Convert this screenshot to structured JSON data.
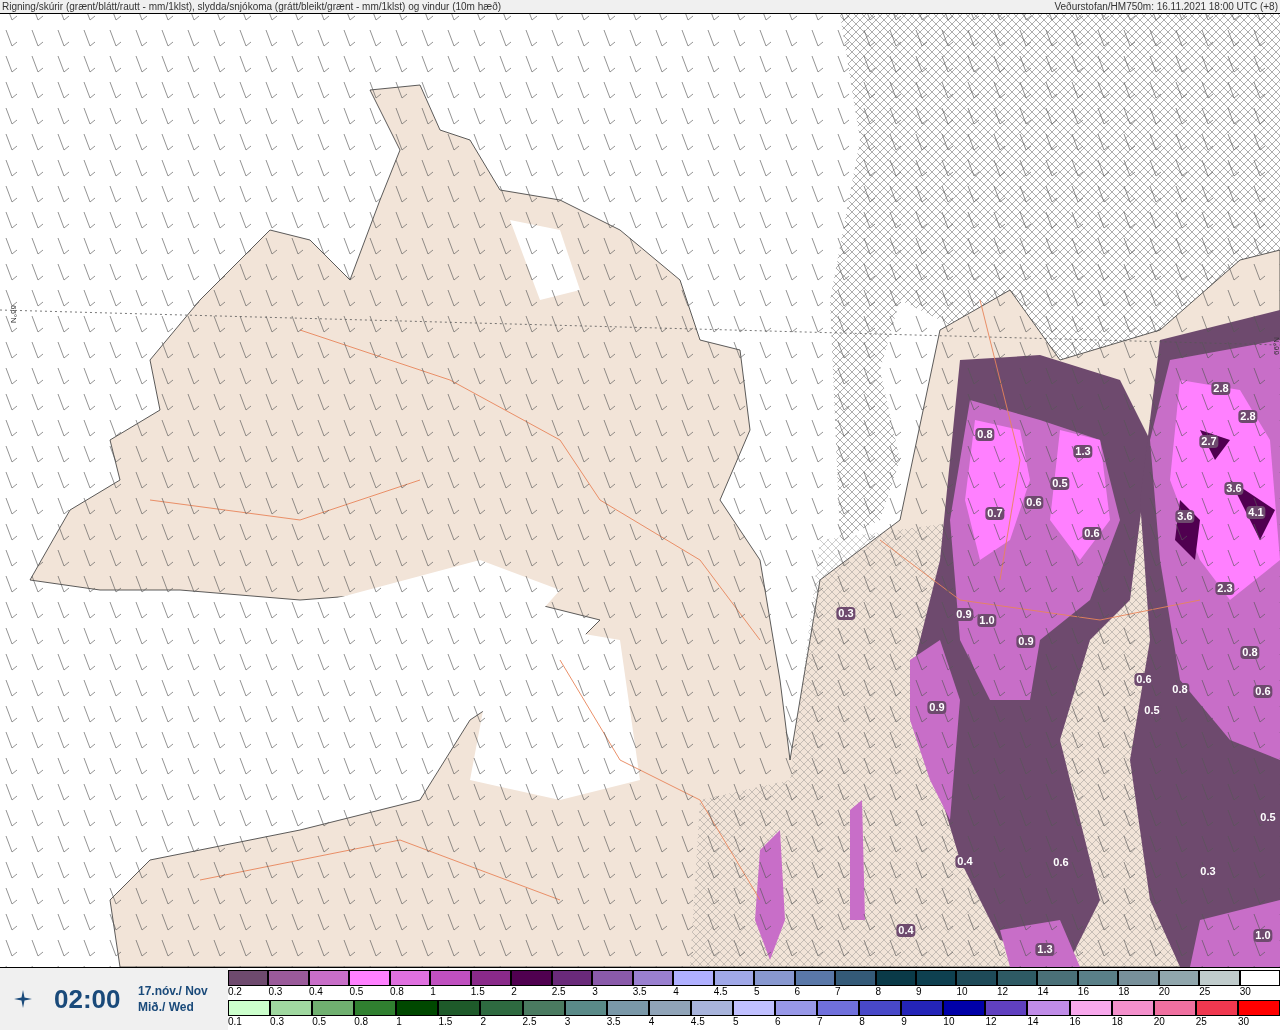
{
  "header": {
    "title": "Rigning/skúrir (grænt/blátt/rautt - mm/1klst), slydda/snjókoma (grátt/bleikt/grænt - mm/1klst) og vindur (10m hæð)",
    "source": "Veðurstofan/HM750m: 16.11.2021 18:00 UTC (+8)"
  },
  "map": {
    "latitude_labels": [
      "66°N",
      "66°N"
    ],
    "values": [
      "0.8",
      "1.3",
      "0.5",
      "0.6",
      "0.7",
      "0.6",
      "2.8",
      "2.8",
      "2.7",
      "3.6",
      "3.6",
      "4.1",
      "2.3",
      "0.3",
      "0.9",
      "1.0",
      "0.9",
      "0.8",
      "0.6",
      "0.8",
      "0.6",
      "0.5",
      "0.9",
      "0.5",
      "0.3",
      "0.4",
      "0.6",
      "0.4",
      "1.3",
      "1.0"
    ]
  },
  "time_panel": {
    "time": "02:00",
    "date": "17.nóv./ Nov",
    "weekday": "Mið./ Wed"
  },
  "legend": [
    {
      "items": [
        {
          "label": "0.2",
          "color": "#6e4a6e"
        },
        {
          "label": "0.3",
          "color": "#9a5a9a"
        },
        {
          "label": "0.4",
          "color": "#c86ec8"
        },
        {
          "label": "0.5",
          "color": "#ff80ff"
        },
        {
          "label": "0.8",
          "color": "#e070e0"
        },
        {
          "label": "1",
          "color": "#c050c0"
        },
        {
          "label": "1.5",
          "color": "#8a2a8a"
        },
        {
          "label": "2",
          "color": "#500050"
        },
        {
          "label": "2.5",
          "color": "#6a2a7a"
        },
        {
          "label": "3",
          "color": "#8a5aaa"
        },
        {
          "label": "3.5",
          "color": "#9a80d0"
        },
        {
          "label": "4",
          "color": "#b0b0ff"
        },
        {
          "label": "4.5",
          "color": "#a0a8e8"
        },
        {
          "label": "5",
          "color": "#8898d0"
        },
        {
          "label": "6",
          "color": "#5a78a8"
        },
        {
          "label": "7",
          "color": "#345a78"
        },
        {
          "label": "8",
          "color": "#0a3a48"
        },
        {
          "label": "9",
          "color": "#0e4050"
        },
        {
          "label": "10",
          "color": "#1e4a58"
        },
        {
          "label": "12",
          "color": "#2e5a64"
        },
        {
          "label": "14",
          "color": "#4a7078"
        },
        {
          "label": "16",
          "color": "#5a8088"
        },
        {
          "label": "18",
          "color": "#78909a"
        },
        {
          "label": "20",
          "color": "#90a6ac"
        },
        {
          "label": "25",
          "color": "#c0cccc"
        },
        {
          "label": "30",
          "color": "#ffffff"
        }
      ]
    },
    {
      "items": [
        {
          "label": "0.1",
          "color": "#ccffcc"
        },
        {
          "label": "0.3",
          "color": "#a0d8a0"
        },
        {
          "label": "0.5",
          "color": "#70b070"
        },
        {
          "label": "0.8",
          "color": "#308030"
        },
        {
          "label": "1",
          "color": "#004800"
        },
        {
          "label": "1.5",
          "color": "#1e5a2a"
        },
        {
          "label": "2",
          "color": "#2e6a40"
        },
        {
          "label": "2.5",
          "color": "#4a7a60"
        },
        {
          "label": "3",
          "color": "#5a8a88"
        },
        {
          "label": "3.5",
          "color": "#7a98a8"
        },
        {
          "label": "4",
          "color": "#90a4b8"
        },
        {
          "label": "4.5",
          "color": "#a8b4dc"
        },
        {
          "label": "5",
          "color": "#c0c0ff"
        },
        {
          "label": "6",
          "color": "#9898e8"
        },
        {
          "label": "7",
          "color": "#7070dc"
        },
        {
          "label": "8",
          "color": "#4848c8"
        },
        {
          "label": "9",
          "color": "#2424b8"
        },
        {
          "label": "10",
          "color": "#0000a8"
        },
        {
          "label": "12",
          "color": "#6040c0"
        },
        {
          "label": "14",
          "color": "#c08ce8"
        },
        {
          "label": "16",
          "color": "#f8a8ec"
        },
        {
          "label": "18",
          "color": "#f490cc"
        },
        {
          "label": "20",
          "color": "#f070a0"
        },
        {
          "label": "25",
          "color": "#f03850"
        },
        {
          "label": "30",
          "color": "#ff0000"
        }
      ]
    }
  ]
}
